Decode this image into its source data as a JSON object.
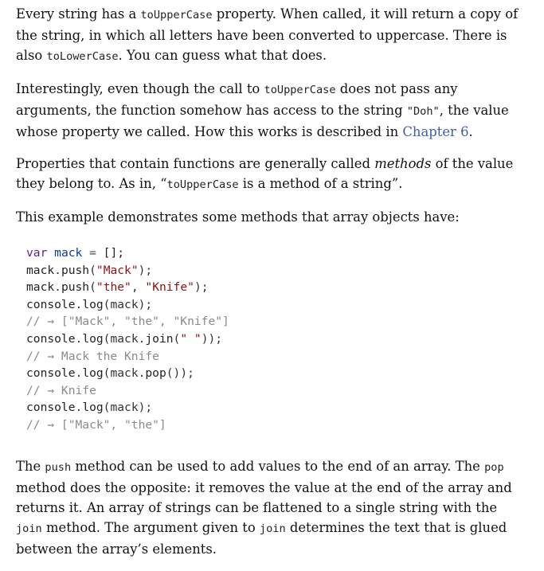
{
  "para1": {
    "t1": "Every string has a ",
    "c1": "toUpperCase",
    "t2": " property. When called, it will return a copy of the string, in which all letters have been converted to uppercase. There is also ",
    "c2": "toLowerCase",
    "t3": ". You can guess what that does."
  },
  "para2": {
    "t1": "Interestingly, even though the call to ",
    "c1": "toUpperCase",
    "t2": " does not pass any arguments, the function somehow has access to the string ",
    "c2": "\"Doh\"",
    "t3": ", the value whose property we called. How this works is described in ",
    "link": "Chapter 6",
    "t4": "."
  },
  "para3": {
    "t1": "Properties that contain functions are generally called ",
    "em": "methods",
    "t2": " of the value they belong to. As in, “",
    "c1": "toUpperCase",
    "t3": " is a method of a string”."
  },
  "para4": {
    "t1": "This example demonstrates some methods that array objects have:"
  },
  "code": {
    "l1": {
      "kw": "var",
      "name": "mack",
      "op": " = ",
      "rest": "[];"
    },
    "l2": {
      "obj": "mack",
      "dot": ".",
      "fn": "push",
      "open": "(",
      "s1": "\"Mack\"",
      "close": ");"
    },
    "l3": {
      "obj": "mack",
      "dot": ".",
      "fn": "push",
      "open": "(",
      "s1": "\"the\"",
      "sep": ", ",
      "s2": "\"Knife\"",
      "close": ");"
    },
    "l4": {
      "obj": "console",
      "dot": ".",
      "fn": "log",
      "rest": "(mack);"
    },
    "l5": {
      "cm": "// → [\"Mack\", \"the\", \"Knife\"]"
    },
    "l6": {
      "obj": "console",
      "dot": ".",
      "fn": "log",
      "open": "(mack.",
      "fn2": "join",
      "open2": "(",
      "s1": "\" \"",
      "close": "));"
    },
    "l7": {
      "cm": "// → Mack the Knife"
    },
    "l8": {
      "obj": "console",
      "dot": ".",
      "fn": "log",
      "open": "(mack.",
      "fn2": "pop",
      "close": "());"
    },
    "l9": {
      "cm": "// → Knife"
    },
    "l10": {
      "obj": "console",
      "dot": ".",
      "fn": "log",
      "rest": "(mack);"
    },
    "l11": {
      "cm": "// → [\"Mack\", \"the\"]"
    }
  },
  "para5": {
    "t1": "The ",
    "c1": "push",
    "t2": " method can be used to add values to the end of an array. The ",
    "c2": "pop",
    "t3": " method does the opposite: it removes the value at the end of the array and returns it. An array of strings can be flattened to a single string with the ",
    "c3": "join",
    "t4": " method. The argument given to ",
    "c4": "join",
    "t5": " determines the text that is glued between the array’s elements."
  }
}
